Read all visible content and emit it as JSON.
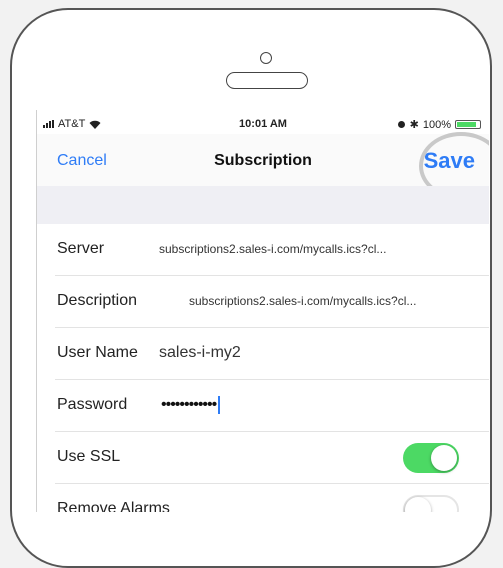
{
  "status_bar": {
    "carrier": "AT&T",
    "time": "10:01 AM",
    "battery_percent": "100%",
    "icons": [
      "signal-icon",
      "wifi-icon",
      "alarm-icon",
      "bluetooth-icon",
      "battery-icon"
    ]
  },
  "nav": {
    "cancel_label": "Cancel",
    "title": "Subscription",
    "save_label": "Save"
  },
  "form": {
    "server": {
      "label": "Server",
      "value": "subscriptions2.sales-i.com/mycalls.ics?cl..."
    },
    "description": {
      "label": "Description",
      "value": "subscriptions2.sales-i.com/mycalls.ics?cl..."
    },
    "user_name": {
      "label": "User Name",
      "value": "sales-i-my2"
    },
    "password": {
      "label": "Password",
      "value": "••••••••••••"
    },
    "use_ssl": {
      "label": "Use SSL",
      "enabled": true
    },
    "remove_alarms": {
      "label": "Remove Alarms",
      "enabled": false
    }
  },
  "colors": {
    "accent": "#2e7cf6",
    "toggle_on": "#4cd964"
  }
}
